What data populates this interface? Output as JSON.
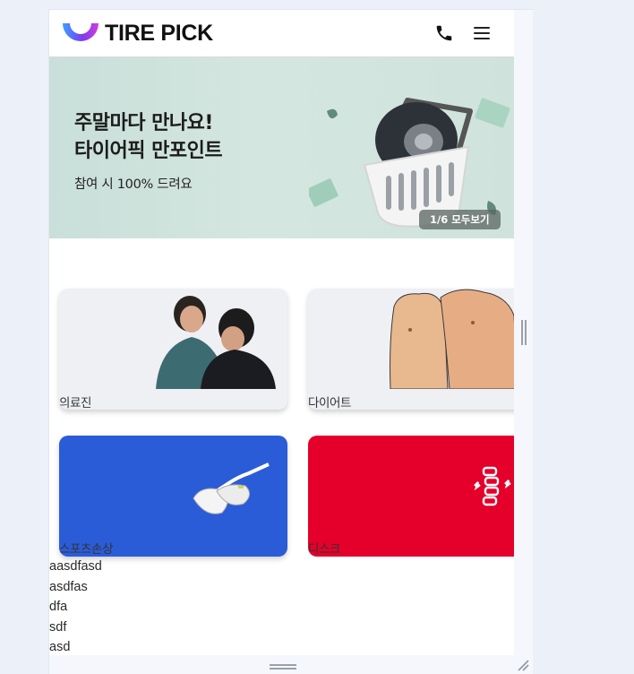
{
  "header": {
    "brand": "TIRE PICK",
    "icons": {
      "phone": "phone-icon",
      "menu": "hamburger-menu-icon",
      "logo": "logo-mark-icon"
    }
  },
  "banner": {
    "title": "주말마다 만나요!\n타이어픽 만포인트",
    "subtitle": "참여 시 100% 드려요",
    "pager": "1/6 모두보기"
  },
  "categories": [
    {
      "label": "의료진"
    },
    {
      "label": "다이어트"
    },
    {
      "label": "스포츠손상"
    },
    {
      "label": "디스크"
    }
  ],
  "list_items": [
    "aasdfasd",
    "asdfas",
    "dfa",
    "sdf",
    "asd"
  ],
  "colors": {
    "sports_card": "#2b5cd8",
    "disc_card": "#e4002b",
    "logo_gradient": [
      "#3aa0ff",
      "#7b3cf0",
      "#d23cdc"
    ]
  }
}
